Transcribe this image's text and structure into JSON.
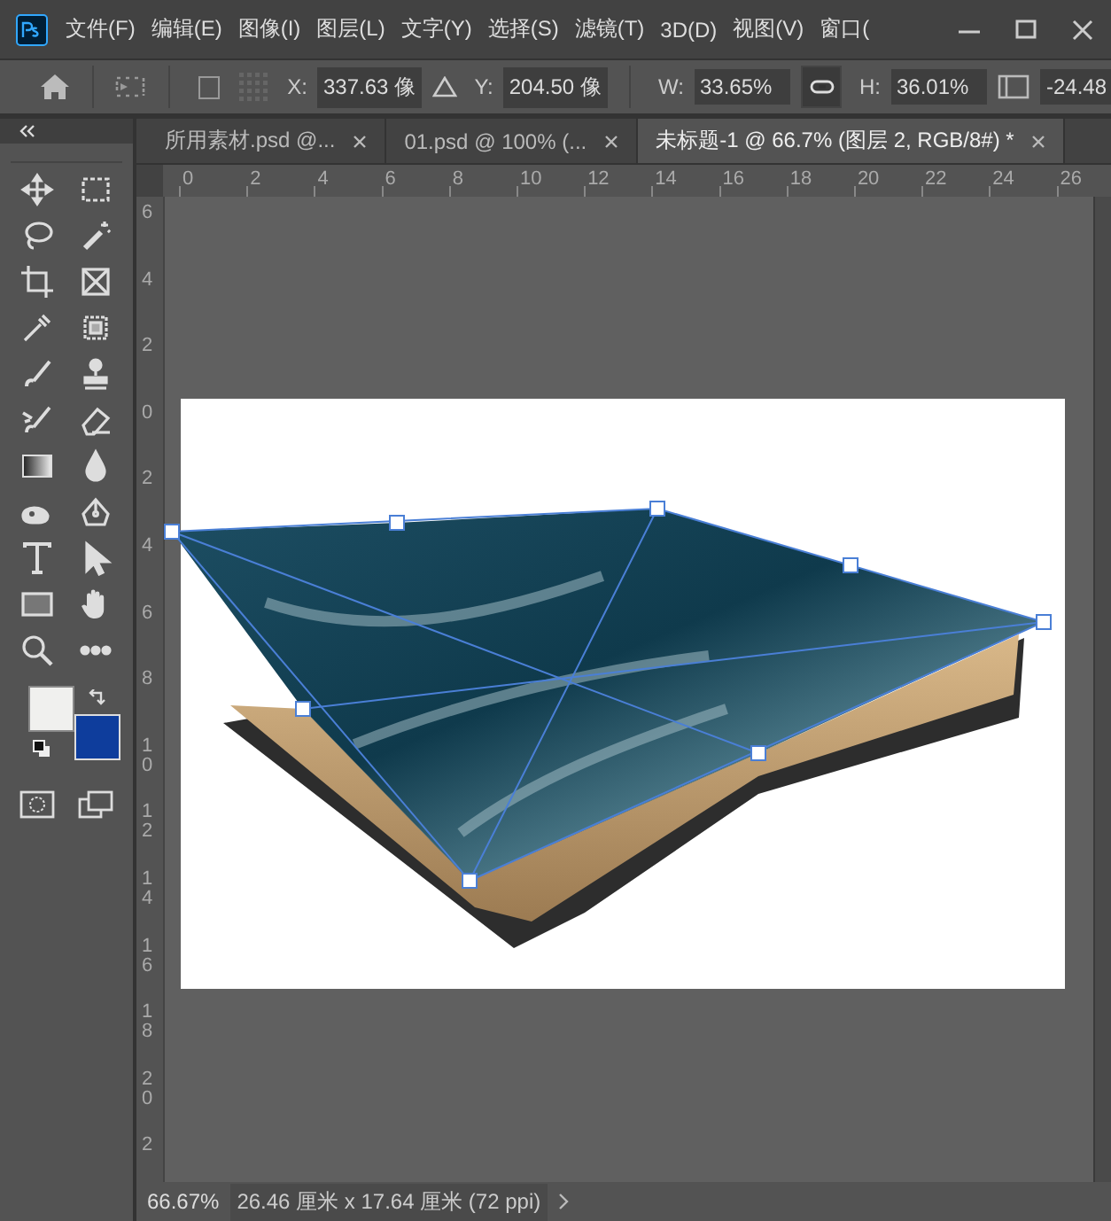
{
  "menu_bar": {
    "items": [
      "文件(F)",
      "编辑(E)",
      "图像(I)",
      "图层(L)",
      "文字(Y)",
      "选择(S)",
      "滤镜(T)",
      "3D(D)",
      "视图(V)",
      "窗口("
    ]
  },
  "options_bar": {
    "reference_point_checked": false,
    "x_label": "X:",
    "x_value": "337.63 像",
    "y_label": "Y:",
    "y_value": "204.50 像",
    "w_label": "W:",
    "w_value": "33.65%",
    "link_on": true,
    "h_label": "H:",
    "h_value": "36.01%",
    "angle_value": "-24.48"
  },
  "tabs": [
    {
      "label": "所用素材.psd @...",
      "selected": false
    },
    {
      "label": "01.psd @ 100% (...",
      "selected": false
    },
    {
      "label": "未标题-1 @ 66.7% (图层 2, RGB/8#) *",
      "selected": true
    }
  ],
  "swatches": [
    {
      "kind": "foreground",
      "color": "#f0f0ee"
    },
    {
      "kind": "background",
      "color": "#0e3d9c"
    }
  ],
  "horizontal_ruler": [
    "0",
    "2",
    "4",
    "6",
    "8",
    "10",
    "12",
    "14",
    "16",
    "18",
    "20",
    "22",
    "24",
    "26"
  ],
  "vertical_ruler": [
    "6",
    "4",
    "2",
    "0",
    "2",
    "4",
    "6",
    "8",
    "10",
    "12",
    "14",
    "16",
    "18",
    "20",
    "2"
  ],
  "status_bar": {
    "zoom": "66.67%",
    "document_info": "26.46 厘米 x 17.64 厘米 (72 ppi)"
  }
}
